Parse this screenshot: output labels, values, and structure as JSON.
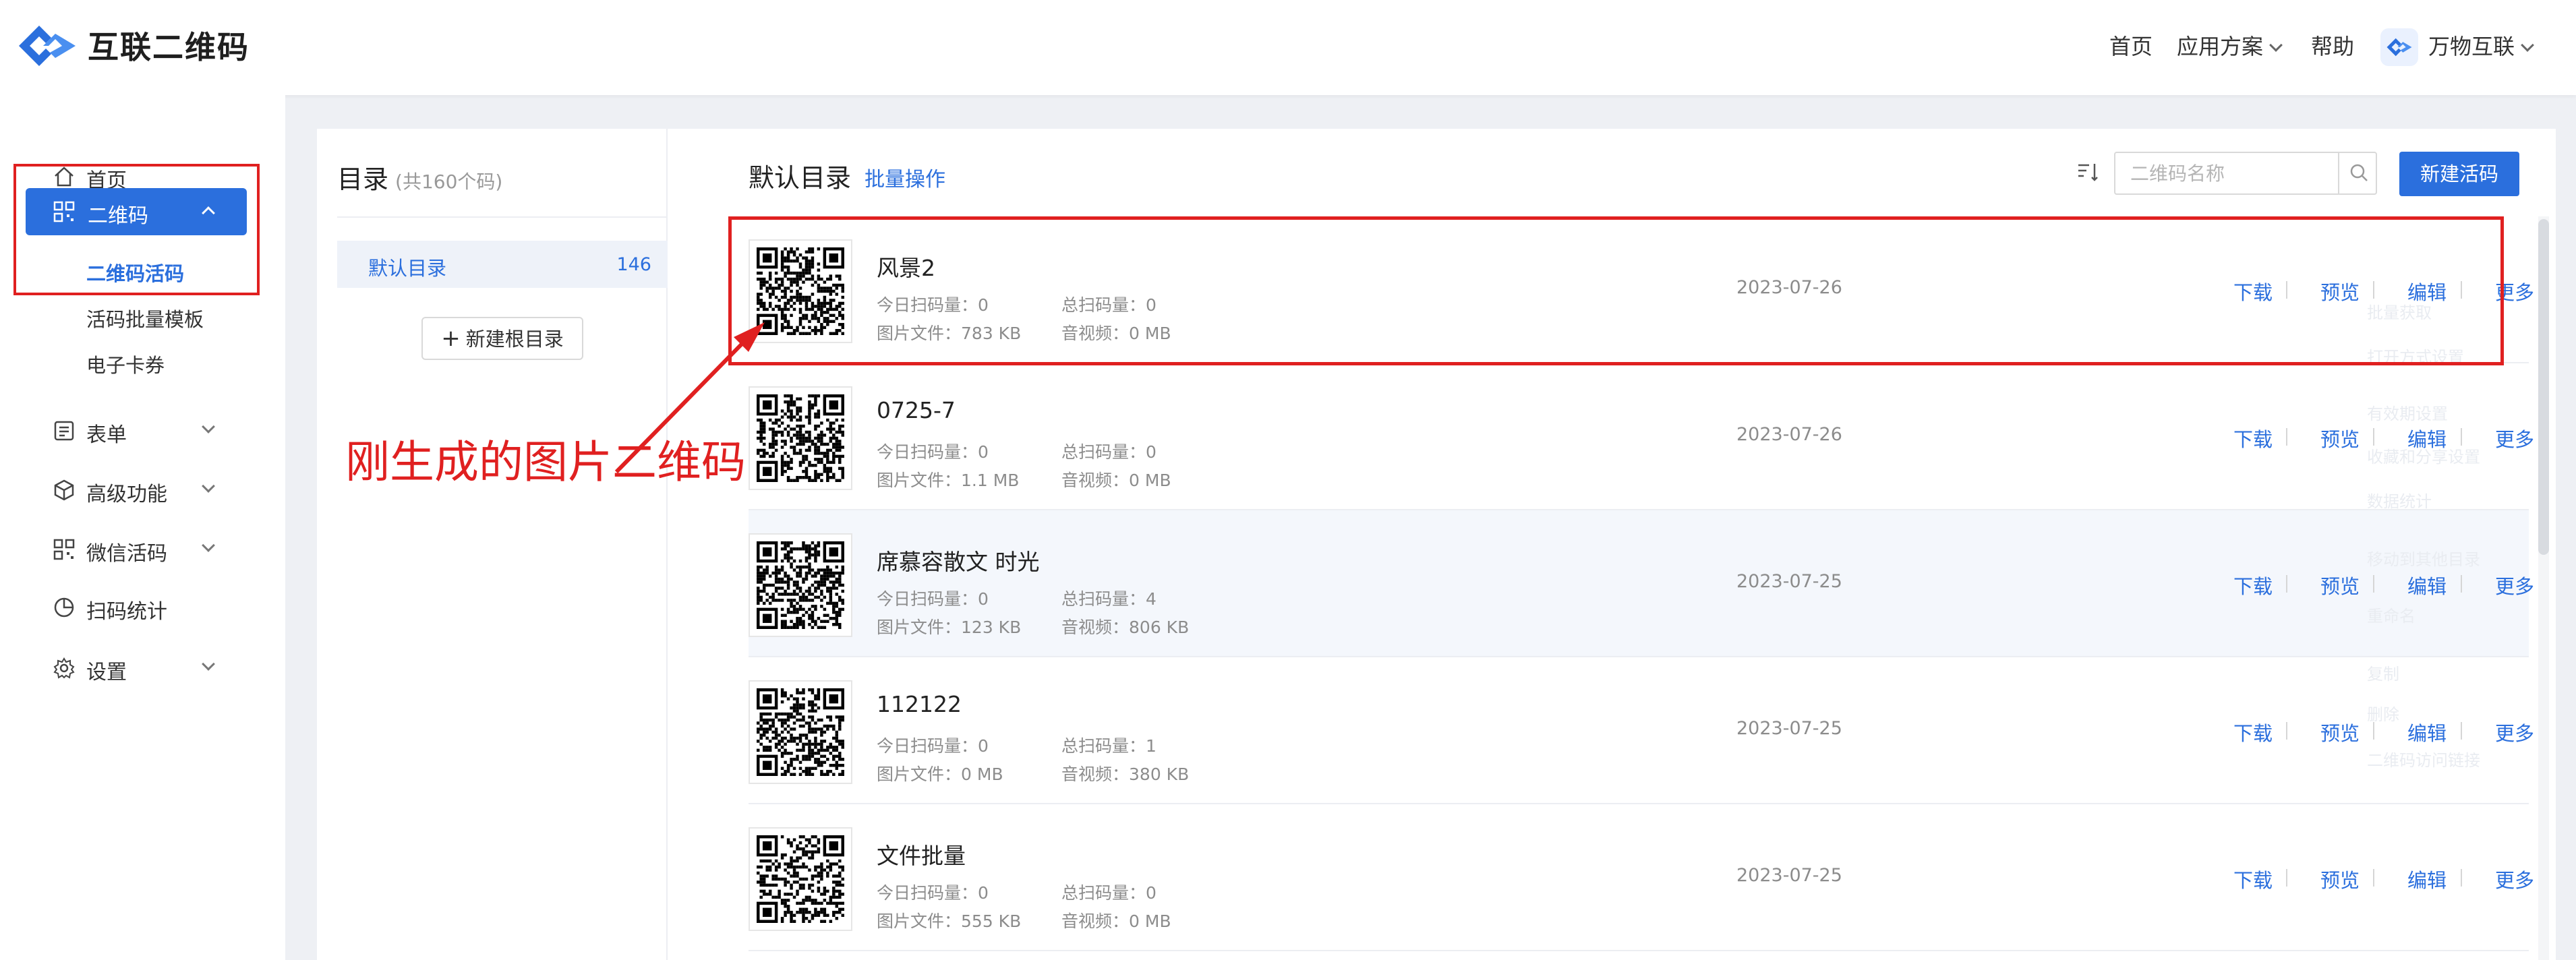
{
  "header": {
    "brand": "互联二维码",
    "nav": [
      "首页",
      "应用方案",
      "帮助"
    ],
    "account": "万物互联"
  },
  "sidebar": {
    "home": "首页",
    "qrcode": "二维码",
    "sub_items": [
      "二维码活码",
      "活码批量模板",
      "电子卡券"
    ],
    "items": [
      "表单",
      "高级功能",
      "微信活码",
      "扫码统计",
      "设置"
    ]
  },
  "directory": {
    "title": "目录",
    "count": "(共160个码)",
    "default_dir": "默认目录",
    "default_count": "146",
    "new_root": "新建根目录"
  },
  "main": {
    "title": "默认目录",
    "batch": "批量操作",
    "search_placeholder": "二维码名称",
    "new_button": "新建活码",
    "labels": {
      "today": "今日扫码量：",
      "total": "总扫码量：",
      "image": "图片文件：",
      "video": "音视频："
    },
    "actions": [
      "下载",
      "预览",
      "编辑",
      "更多"
    ],
    "rows": [
      {
        "name": "风景2",
        "today": "0",
        "total": "0",
        "image": "783 KB",
        "video": "0 MB",
        "date": "2023-07-26"
      },
      {
        "name": "0725-7",
        "today": "0",
        "total": "0",
        "image": "1.1 MB",
        "video": "0 MB",
        "date": "2023-07-26"
      },
      {
        "name": "席慕容散文 时光",
        "today": "0",
        "total": "4",
        "image": "123 KB",
        "video": "806 KB",
        "date": "2023-07-25"
      },
      {
        "name": "112122",
        "today": "0",
        "total": "1",
        "image": "0 MB",
        "video": "380 KB",
        "date": "2023-07-25"
      },
      {
        "name": "文件批量",
        "today": "0",
        "total": "0",
        "image": "555 KB",
        "video": "0 MB",
        "date": "2023-07-25"
      }
    ],
    "ghost_menu": [
      "批量获取",
      "打开方式设置",
      "有效期设置",
      "收藏和分享设置",
      "数据统计",
      "移动到其他目录",
      "重命名",
      "复制",
      "删除",
      "二维码访问链接"
    ]
  },
  "annotation": {
    "text": "刚生成的图片二维码"
  },
  "colors": {
    "accent": "#2b6fdd",
    "annotation": "#e02020"
  }
}
